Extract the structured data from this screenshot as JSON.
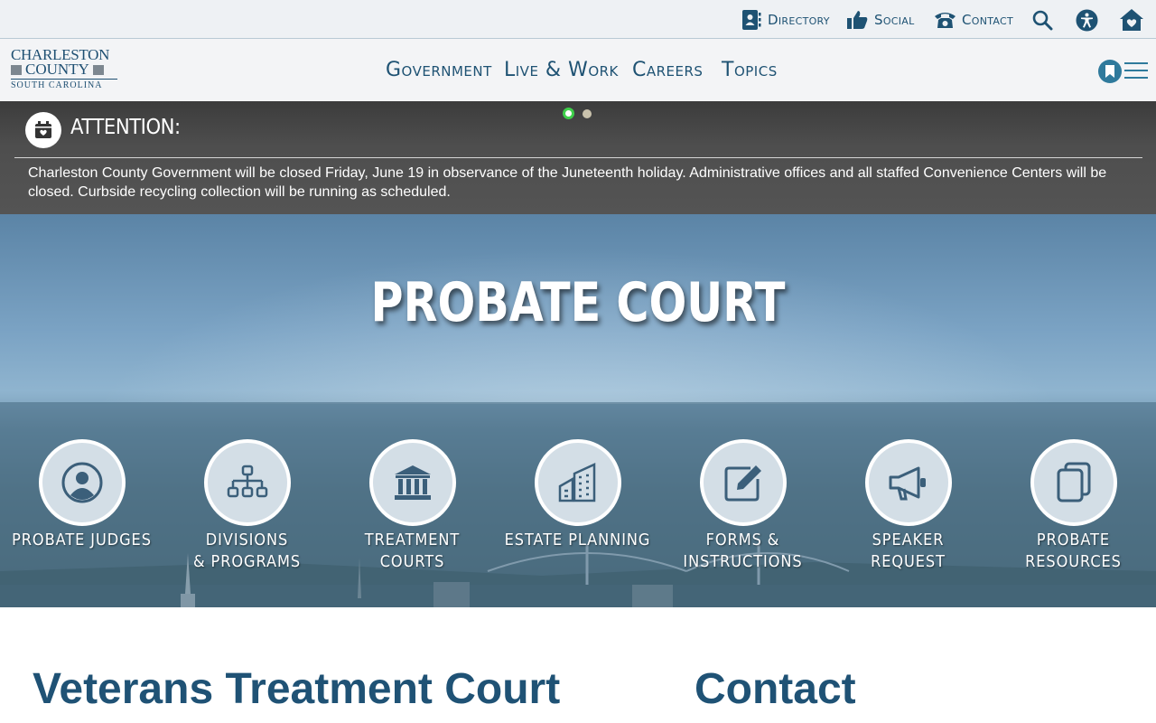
{
  "utility": {
    "directory": "Directory",
    "social": "Social",
    "contact": "Contact"
  },
  "logo": {
    "line1": "CHARLESTON",
    "line2": "COUNTY",
    "line3": "SOUTH CAROLINA"
  },
  "nav": {
    "government": "Government",
    "live_work": "Live & Work",
    "careers": "Careers",
    "topics": "Topics"
  },
  "alert": {
    "heading": "ATTENTION:",
    "message": "Charleston County Government will be closed Friday, June 19 in observance of the Juneteenth holiday. Administrative offices and all staffed Convenience Centers will be closed. Curbside recycling collection will be running as scheduled.",
    "slide_count": 2,
    "active_slide": 1
  },
  "hero": {
    "title": "PROBATE COURT",
    "links": [
      {
        "line1": "PROBATE JUDGES",
        "line2": "",
        "icon": "person-icon"
      },
      {
        "line1": "DIVISIONS",
        "line2": "& PROGRAMS",
        "icon": "org-chart-icon"
      },
      {
        "line1": "TREATMENT",
        "line2": "COURTS",
        "icon": "courthouse-icon"
      },
      {
        "line1": "ESTATE PLANNING",
        "line2": "",
        "icon": "buildings-icon"
      },
      {
        "line1": "FORMS &",
        "line2": "INSTRUCTIONS",
        "icon": "edit-form-icon"
      },
      {
        "line1": "SPEAKER REQUEST",
        "line2": "",
        "icon": "megaphone-icon"
      },
      {
        "line1": "PROBATE",
        "line2": "RESOURCES",
        "icon": "documents-icon"
      }
    ]
  },
  "content": {
    "left_heading": "Veterans Treatment Court",
    "right_heading": "Contact"
  },
  "colors": {
    "brand_blue": "#1e5273",
    "accent_teal": "#2f7a9c",
    "alert_bg": "#4a4a4a",
    "active_dot": "#3ecf4a"
  }
}
